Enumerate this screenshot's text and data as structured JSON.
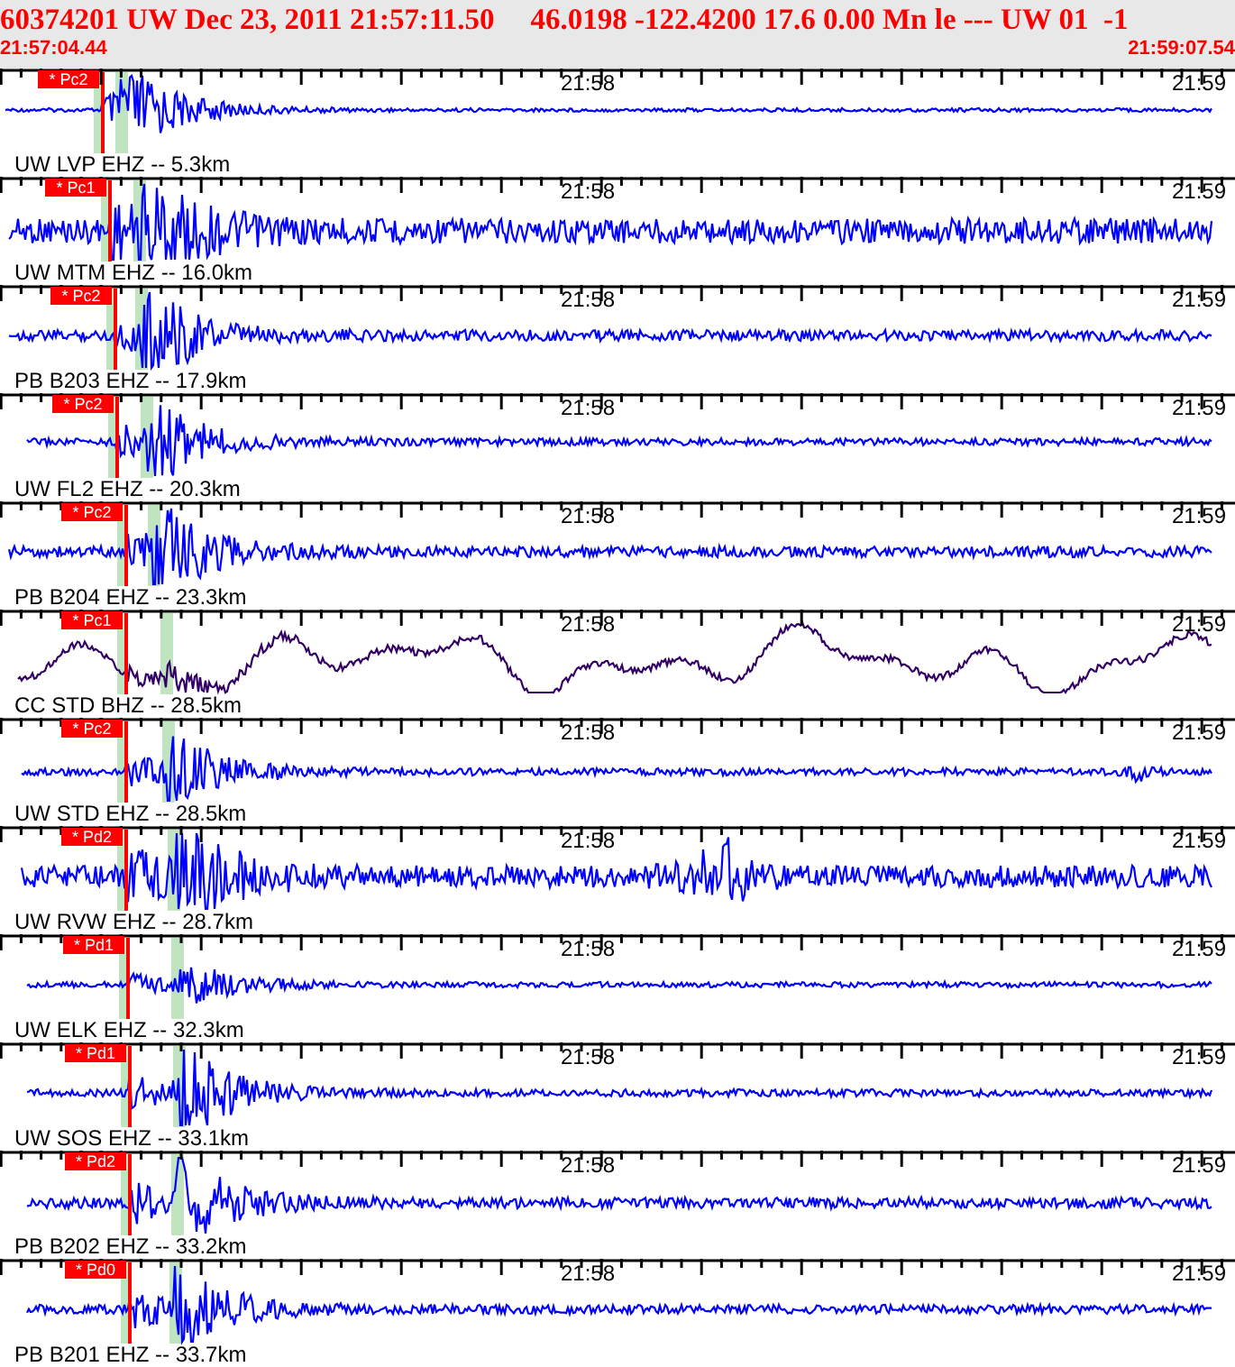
{
  "header": {
    "title": "60374201 UW Dec 23, 2011 21:57:11.50",
    "details": "46.0198 -122.4200 17.6 0.00 Mn le --- UW 01  -1",
    "start_time": "21:57:04.44",
    "end_time": "21:59:07.54"
  },
  "traces": [
    {
      "station": "UW LVP EHZ -- 5.3km",
      "pick": "* Pc2",
      "tick_labels": [
        "21:58",
        "21:59"
      ],
      "color": "#0000ff"
    },
    {
      "station": "UW MTM EHZ -- 16.0km",
      "pick": "* Pc1",
      "tick_labels": [
        "21:58",
        "21:59"
      ],
      "color": "#0000ff"
    },
    {
      "station": "PB B203 EHZ -- 17.9km",
      "pick": "* Pc2",
      "tick_labels": [
        "21:58",
        "21:59"
      ],
      "color": "#0000ff"
    },
    {
      "station": "UW FL2 EHZ -- 20.3km",
      "pick": "* Pc2",
      "tick_labels": [
        "21:58",
        "21:59"
      ],
      "color": "#0000ff"
    },
    {
      "station": "PB B204 EHZ -- 23.3km",
      "pick": "* Pc2",
      "tick_labels": [
        "21:58",
        "21:59"
      ],
      "color": "#0000ff"
    },
    {
      "station": "CC STD BHZ -- 28.5km",
      "pick": "* Pc1",
      "tick_labels": [
        "21:58",
        "21:59"
      ],
      "color": "#330066"
    },
    {
      "station": "UW STD EHZ -- 28.5km",
      "pick": "* Pc2",
      "tick_labels": [
        "21:58",
        "21:59"
      ],
      "color": "#0000ff"
    },
    {
      "station": "UW RVW EHZ -- 28.7km",
      "pick": "* Pd2",
      "tick_labels": [
        "21:58",
        "21:59"
      ],
      "color": "#0000ff"
    },
    {
      "station": "UW ELK EHZ -- 32.3km",
      "pick": "* Pd1",
      "tick_labels": [
        "21:58",
        "21:59"
      ],
      "color": "#0000ff"
    },
    {
      "station": "UW SOS EHZ -- 33.1km",
      "pick": "* Pd1",
      "tick_labels": [
        "21:58",
        "21:59"
      ],
      "color": "#0000ff"
    },
    {
      "station": "PB B202 EHZ -- 33.2km",
      "pick": "* Pd2",
      "tick_labels": [
        "21:58",
        "21:59"
      ],
      "color": "#0000ff"
    },
    {
      "station": "PB B201 EHZ -- 33.7km",
      "pick": "* Pd0",
      "tick_labels": [
        "21:58",
        "21:59"
      ],
      "color": "#0000ff"
    }
  ]
}
